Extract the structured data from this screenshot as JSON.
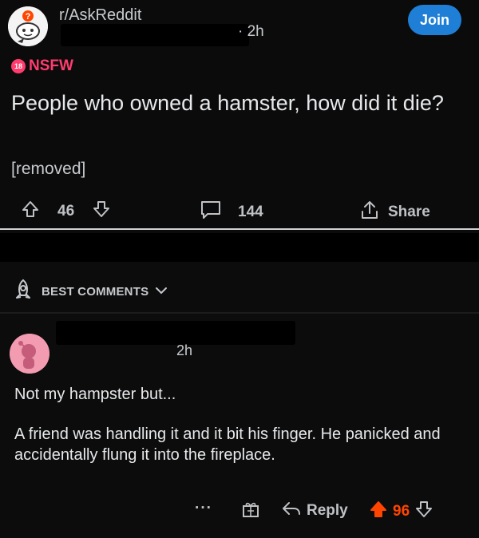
{
  "post": {
    "subreddit": "r/AskReddit",
    "age": "· 2h",
    "join_label": "Join",
    "nsfw_badge": "18",
    "nsfw_label": "NSFW",
    "title": "People who owned a hamster, how did it die?",
    "body": "[removed]",
    "upvotes": "46",
    "comments": "144",
    "share_label": "Share"
  },
  "comment_section": {
    "sort_label": "BEST COMMENTS",
    "comment": {
      "age": "2h",
      "line1": "Not my hampster but...",
      "body": "A friend was handling it and it bit his finger.  He panicked and accidentally flung it into the fireplace.",
      "more_label": "···",
      "reply_label": "Reply",
      "score": "96"
    }
  },
  "colors": {
    "accent_blue": "#1f7fd6",
    "nsfw_pink": "#ff3c6d",
    "upvote_orange": "#ff4500"
  }
}
